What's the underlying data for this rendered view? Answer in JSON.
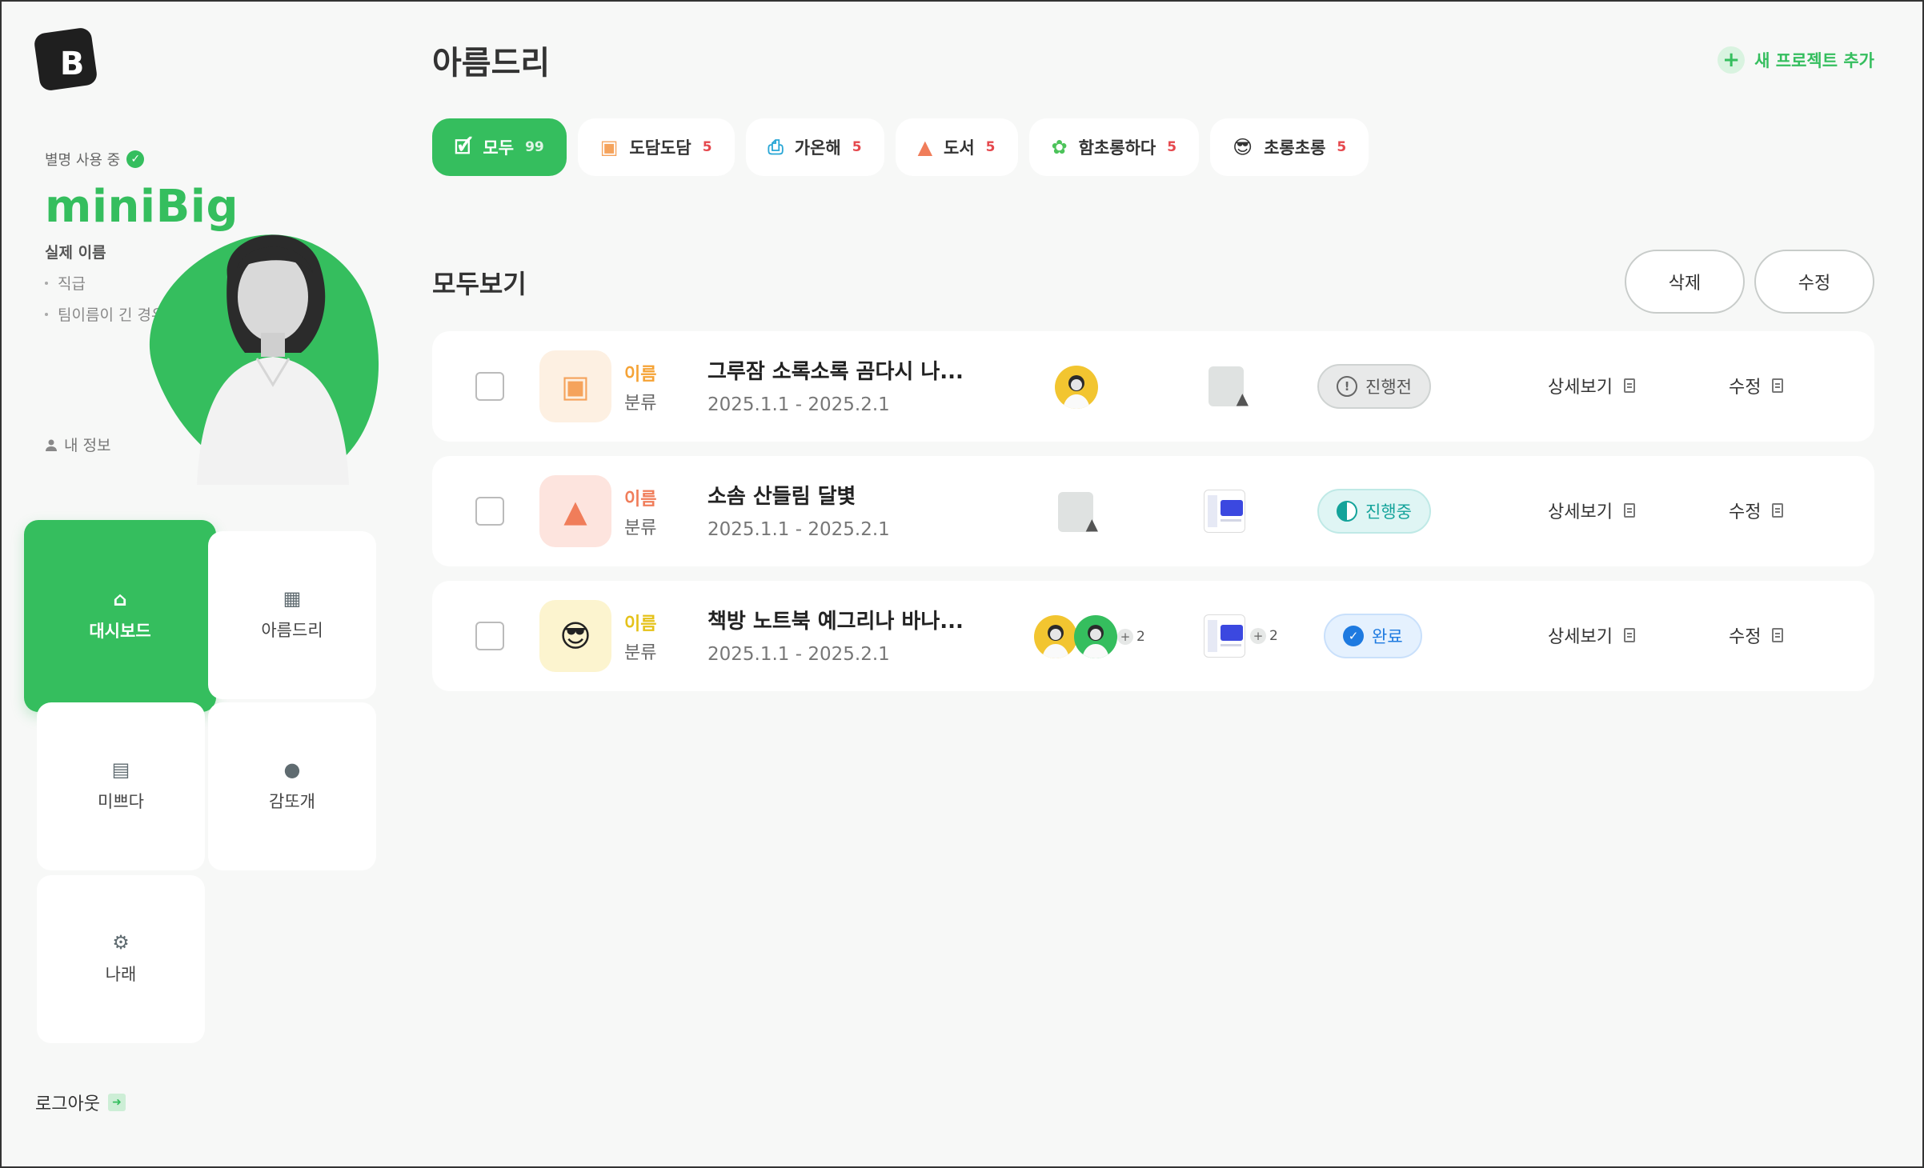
{
  "app": {
    "logo_letter": "B"
  },
  "profile": {
    "nickname_status": "별명 사용 중",
    "nickname": "miniBig",
    "real_name": "실제 이름",
    "sub_items": [
      "직급",
      "팀이름이 긴 경우"
    ],
    "my_info": "내 정보"
  },
  "nav": {
    "tiles": [
      {
        "label": "대시보드",
        "icon": "home-icon",
        "active": true
      },
      {
        "label": "아름드리",
        "icon": "grid-plus-icon",
        "active": false
      },
      {
        "label": "미쁘다",
        "icon": "archive-icon",
        "active": false
      },
      {
        "label": "감또개",
        "icon": "person-icon",
        "active": false
      },
      {
        "label": "나래",
        "icon": "gear-icon",
        "active": false
      }
    ],
    "logout": "로그아웃"
  },
  "header": {
    "title": "아름드리",
    "new_project": "새 프로젝트 추가"
  },
  "filters": [
    {
      "label": "모두",
      "count": "99",
      "icon": "folder-check-icon",
      "active": true
    },
    {
      "label": "도담도담",
      "count": "5",
      "icon": "presentation-icon",
      "active": false
    },
    {
      "label": "가온해",
      "count": "5",
      "icon": "printer-icon",
      "active": false
    },
    {
      "label": "도서",
      "count": "5",
      "icon": "shapes-icon",
      "active": false
    },
    {
      "label": "함초롱하다",
      "count": "5",
      "icon": "flower-icon",
      "active": false
    },
    {
      "label": "초롱초롱",
      "count": "5",
      "icon": "sunglasses-emoji-icon",
      "active": false
    }
  ],
  "section": {
    "title": "모두보기",
    "delete_label": "삭제",
    "edit_label": "수정"
  },
  "rows": [
    {
      "name": "이름",
      "category": "분류",
      "title": "그루잠 소록소록 곰다시 나...",
      "date": "2025.1.1 - 2025.2.1",
      "status": "진행전",
      "more_people": "",
      "more_files": "",
      "detail": "상세보기",
      "edit": "수정"
    },
    {
      "name": "이름",
      "category": "분류",
      "title": "소솜 산들림 달볓",
      "date": "2025.1.1 - 2025.2.1",
      "status": "진행중",
      "more_people": "",
      "more_files": "",
      "detail": "상세보기",
      "edit": "수정"
    },
    {
      "name": "이름",
      "category": "분류",
      "title": "책방 노트북 예그리나 바나...",
      "date": "2025.1.1 - 2025.2.1",
      "status": "완료",
      "more_people": "2",
      "more_files": "2",
      "detail": "상세보기",
      "edit": "수정"
    }
  ],
  "colors": {
    "accent": "#35be5e",
    "danger": "#e5484d",
    "status_ready": "#e8e9e9",
    "status_ongoing": "#14a39a",
    "status_done": "#1e7ae0"
  }
}
